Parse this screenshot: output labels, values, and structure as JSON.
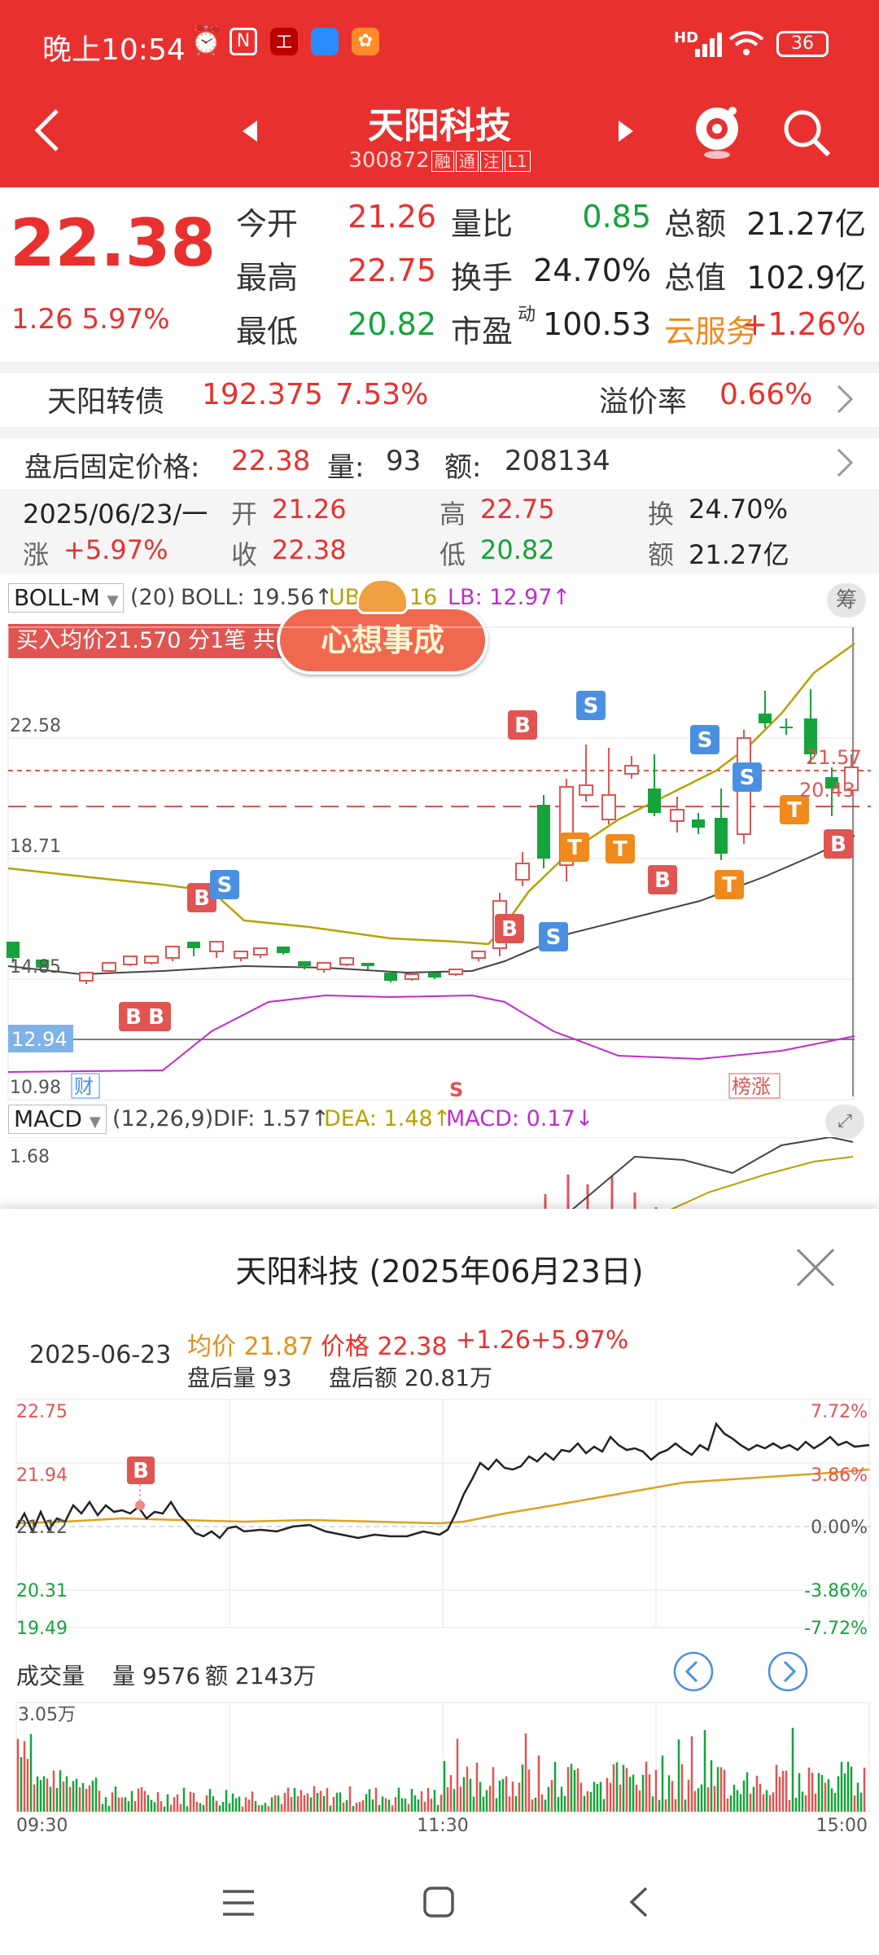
{
  "status": {
    "time": "晚上10:54",
    "battery": "36",
    "net": "HD"
  },
  "header": {
    "title": "天阳科技",
    "code": "300872",
    "tags": [
      "融",
      "通",
      "注",
      "L1"
    ]
  },
  "quote": {
    "price": "22.38",
    "change": "1.26",
    "pct": "5.97%",
    "rows": [
      [
        {
          "k": "今开",
          "v": "21.26",
          "c": "red"
        },
        {
          "k": "量比",
          "v": "0.85",
          "c": "green"
        },
        {
          "k": "总额",
          "v": "21.27亿",
          "c": "dark"
        }
      ],
      [
        {
          "k": "最高",
          "v": "22.75",
          "c": "red"
        },
        {
          "k": "换手",
          "v": "24.70%",
          "c": "dark"
        },
        {
          "k": "总值",
          "v": "102.9亿",
          "c": "dark"
        }
      ],
      [
        {
          "k": "最低",
          "v": "20.82",
          "c": "green"
        },
        {
          "k": "市盈",
          "sup": "动",
          "v": "100.53",
          "c": "dark"
        },
        {
          "k": "云服务",
          "v": "+1.26%",
          "c": "red",
          "korange": true
        }
      ]
    ]
  },
  "bond": {
    "name": "天阳转债",
    "price": "192.375",
    "pct": "7.53%",
    "premium_label": "溢价率",
    "premium": "0.66%"
  },
  "afterhours": {
    "label": "盘后固定价格:",
    "price": "22.38",
    "vol_label": "量:",
    "vol": "93",
    "amt_label": "额:",
    "amt": "208134"
  },
  "daybar": {
    "date": "2025/06/23/一",
    "open_k": "开",
    "open": "21.26",
    "high_k": "高",
    "high": "22.75",
    "turn_k": "换",
    "turn": "24.70%",
    "chg_k": "涨",
    "chg": "+5.97%",
    "close_k": "收",
    "close": "22.38",
    "low_k": "低",
    "low": "20.82",
    "amt_k": "额",
    "amt": "21.27亿"
  },
  "kline": {
    "indicator": "BOLL-M",
    "params": "(20)",
    "boll": "BOLL: 19.56↑",
    "ub": "UB: 26.16",
    "lb": "LB: 12.97↑",
    "chou": "筹",
    "buy_banner": "买入均价21.570 分1笔 共",
    "sticker": "心想事成",
    "y_labels": [
      "22.58",
      "18.71",
      "14.85",
      "12.94",
      "10.98"
    ],
    "right_labels": [
      "21.57",
      "20.43"
    ],
    "bottom_tags": [
      "财",
      "S",
      "榜涨"
    ]
  },
  "macd": {
    "label": "MACD",
    "params": "(12,26,9)",
    "dif": "DIF: 1.57↑",
    "dea": "DEA: 1.48↑",
    "macd": "MACD: 0.17↓",
    "y": "1.68"
  },
  "popup": {
    "title": "天阳科技 (2025年06月23日)",
    "date": "2025-06-23",
    "avg": "均价 21.87",
    "price": "价格 22.38",
    "chg": "+1.26",
    "pct": "+5.97%",
    "ah_vol": "盘后量 93",
    "ah_amt": "盘后额 20.81万",
    "y_left": [
      "22.75",
      "21.94",
      "21.12",
      "20.31",
      "19.49"
    ],
    "y_right": [
      "7.72%",
      "3.86%",
      "0.00%",
      "-3.86%",
      "-7.72%"
    ],
    "vol_title": "成交量",
    "vol": "量 9576",
    "amt": "额 2143万",
    "vol_max": "3.05万",
    "times": [
      "09:30",
      "11:30",
      "15:00"
    ]
  }
}
